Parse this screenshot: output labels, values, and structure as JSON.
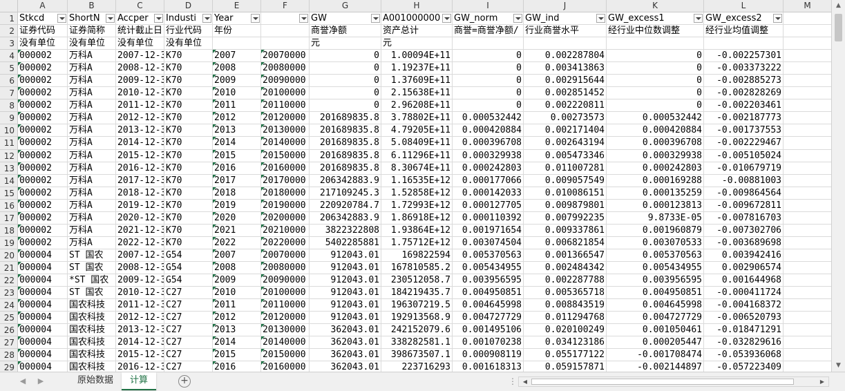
{
  "columns": [
    "A",
    "B",
    "C",
    "D",
    "E",
    "F",
    "G",
    "H",
    "I",
    "J",
    "K",
    "L",
    "M"
  ],
  "row_numbers": [
    "1",
    "2",
    "3",
    "4",
    "5",
    "6",
    "7",
    "8",
    "9",
    "10",
    "11",
    "12",
    "13",
    "14",
    "15",
    "16",
    "17",
    "18",
    "19",
    "20",
    "21",
    "22",
    "23",
    "24",
    "25",
    "26",
    "27",
    "28",
    "29"
  ],
  "header_row": [
    "Stkcd",
    "ShortN",
    "Accper",
    "Industi",
    "Year",
    "",
    "GW",
    "A001000000",
    "GW_norm",
    "GW_ind",
    "GW_excess1",
    "GW_excess2",
    ""
  ],
  "filter_columns": [
    0,
    1,
    2,
    3,
    4,
    5,
    6,
    7,
    8,
    9,
    10,
    11
  ],
  "text_columns": [
    0,
    1,
    2,
    3,
    4,
    5
  ],
  "rows": [
    [
      "证券代码",
      "证券简称",
      "统计截止日",
      "行业代码",
      "年份",
      "",
      "商誉净额",
      "资产总计",
      "商誉=商誉净额/",
      "行业商誉水平",
      "经行业中位数调整",
      "经行业均值调整",
      ""
    ],
    [
      "没有单位",
      "没有单位",
      "没有单位",
      "没有单位",
      "",
      "",
      "元",
      "元",
      "",
      "",
      "",
      "",
      ""
    ],
    [
      "000002",
      "万科A",
      "2007-12-3",
      "K70",
      "2007",
      "20070000",
      "0",
      "1.00094E+11",
      "0",
      "0.002287804",
      "0",
      "-0.002257301",
      ""
    ],
    [
      "000002",
      "万科A",
      "2008-12-3",
      "K70",
      "2008",
      "20080000",
      "0",
      "1.19237E+11",
      "0",
      "0.003413863",
      "0",
      "-0.003373222",
      ""
    ],
    [
      "000002",
      "万科A",
      "2009-12-3",
      "K70",
      "2009",
      "20090000",
      "0",
      "1.37609E+11",
      "0",
      "0.002915644",
      "0",
      "-0.002885273",
      ""
    ],
    [
      "000002",
      "万科A",
      "2010-12-3",
      "K70",
      "2010",
      "20100000",
      "0",
      "2.15638E+11",
      "0",
      "0.002851452",
      "0",
      "-0.002828269",
      ""
    ],
    [
      "000002",
      "万科A",
      "2011-12-3",
      "K70",
      "2011",
      "20110000",
      "0",
      "2.96208E+11",
      "0",
      "0.002220811",
      "0",
      "-0.002203461",
      ""
    ],
    [
      "000002",
      "万科A",
      "2012-12-3",
      "K70",
      "2012",
      "20120000",
      "201689835.8",
      "3.78802E+11",
      "0.000532442",
      "0.00273573",
      "0.000532442",
      "-0.002187773",
      ""
    ],
    [
      "000002",
      "万科A",
      "2013-12-3",
      "K70",
      "2013",
      "20130000",
      "201689835.8",
      "4.79205E+11",
      "0.000420884",
      "0.002171404",
      "0.000420884",
      "-0.001737553",
      ""
    ],
    [
      "000002",
      "万科A",
      "2014-12-3",
      "K70",
      "2014",
      "20140000",
      "201689835.8",
      "5.08409E+11",
      "0.000396708",
      "0.002643194",
      "0.000396708",
      "-0.002229467",
      ""
    ],
    [
      "000002",
      "万科A",
      "2015-12-3",
      "K70",
      "2015",
      "20150000",
      "201689835.8",
      "6.11296E+11",
      "0.000329938",
      "0.005473346",
      "0.000329938",
      "-0.005105024",
      ""
    ],
    [
      "000002",
      "万科A",
      "2016-12-3",
      "K70",
      "2016",
      "20160000",
      "201689835.8",
      "8.30674E+11",
      "0.000242803",
      "0.011007281",
      "0.000242803",
      "-0.010679719",
      ""
    ],
    [
      "000002",
      "万科A",
      "2017-12-3",
      "K70",
      "2017",
      "20170000",
      "206342883.9",
      "1.16535E+12",
      "0.000177066",
      "0.009057549",
      "0.000169288",
      "-0.00881003",
      ""
    ],
    [
      "000002",
      "万科A",
      "2018-12-3",
      "K70",
      "2018",
      "20180000",
      "217109245.3",
      "1.52858E+12",
      "0.000142033",
      "0.010086151",
      "0.000135259",
      "-0.009864564",
      ""
    ],
    [
      "000002",
      "万科A",
      "2019-12-3",
      "K70",
      "2019",
      "20190000",
      "220920784.7",
      "1.72993E+12",
      "0.000127705",
      "0.009879801",
      "0.000123813",
      "-0.009672811",
      ""
    ],
    [
      "000002",
      "万科A",
      "2020-12-3",
      "K70",
      "2020",
      "20200000",
      "206342883.9",
      "1.86918E+12",
      "0.000110392",
      "0.007992235",
      "9.8733E-05",
      "-0.007816703",
      ""
    ],
    [
      "000002",
      "万科A",
      "2021-12-3",
      "K70",
      "2021",
      "20210000",
      "3822322808",
      "1.93864E+12",
      "0.001971654",
      "0.009337861",
      "0.001960879",
      "-0.007302706",
      ""
    ],
    [
      "000002",
      "万科A",
      "2022-12-3",
      "K70",
      "2022",
      "20220000",
      "5402285881",
      "1.75712E+12",
      "0.003074504",
      "0.006821854",
      "0.003070533",
      "-0.003689698",
      ""
    ],
    [
      "000004",
      "ST 国农",
      "2007-12-3",
      "G54",
      "2007",
      "20070000",
      "912043.01",
      "169822594",
      "0.005370563",
      "0.001366547",
      "0.005370563",
      "0.003942416",
      ""
    ],
    [
      "000004",
      "ST 国农",
      "2008-12-3",
      "G54",
      "2008",
      "20080000",
      "912043.01",
      "167810585.2",
      "0.005434955",
      "0.002484342",
      "0.005434955",
      "0.002906574",
      ""
    ],
    [
      "000004",
      "*ST 国农",
      "2009-12-3",
      "G54",
      "2009",
      "20090000",
      "912043.01",
      "230512058.7",
      "0.003956595",
      "0.002287788",
      "0.003956595",
      "0.001644968",
      ""
    ],
    [
      "000004",
      "ST 国农",
      "2010-12-3",
      "C27",
      "2010",
      "20100000",
      "912043.01",
      "184219435.7",
      "0.004950851",
      "0.005365718",
      "0.004950851",
      "-0.000411724",
      ""
    ],
    [
      "000004",
      "国农科技",
      "2011-12-3",
      "C27",
      "2011",
      "20110000",
      "912043.01",
      "196307219.5",
      "0.004645998",
      "0.008843519",
      "0.004645998",
      "-0.004168372",
      ""
    ],
    [
      "000004",
      "国农科技",
      "2012-12-3",
      "C27",
      "2012",
      "20120000",
      "912043.01",
      "192913568.9",
      "0.004727729",
      "0.011294768",
      "0.004727729",
      "-0.006520793",
      ""
    ],
    [
      "000004",
      "国农科技",
      "2013-12-3",
      "C27",
      "2013",
      "20130000",
      "362043.01",
      "242152079.6",
      "0.001495106",
      "0.020100249",
      "0.001050461",
      "-0.018471291",
      ""
    ],
    [
      "000004",
      "国农科技",
      "2014-12-3",
      "C27",
      "2014",
      "20140000",
      "362043.01",
      "338282581.1",
      "0.001070238",
      "0.034123186",
      "0.000205447",
      "-0.032829616",
      ""
    ],
    [
      "000004",
      "国农科技",
      "2015-12-3",
      "C27",
      "2015",
      "20150000",
      "362043.01",
      "398673507.1",
      "0.000908119",
      "0.055177122",
      "-0.001708474",
      "-0.053936068",
      ""
    ],
    [
      "000004",
      "国农科技",
      "2016-12-3",
      "C27",
      "2016",
      "20160000",
      "362043.01",
      "223716293",
      "0.001618313",
      "0.059157871",
      "-0.002144897",
      "-0.057223409",
      ""
    ]
  ],
  "sheet_tabs": [
    "原始数据",
    "计算"
  ],
  "active_sheet": "计算"
}
